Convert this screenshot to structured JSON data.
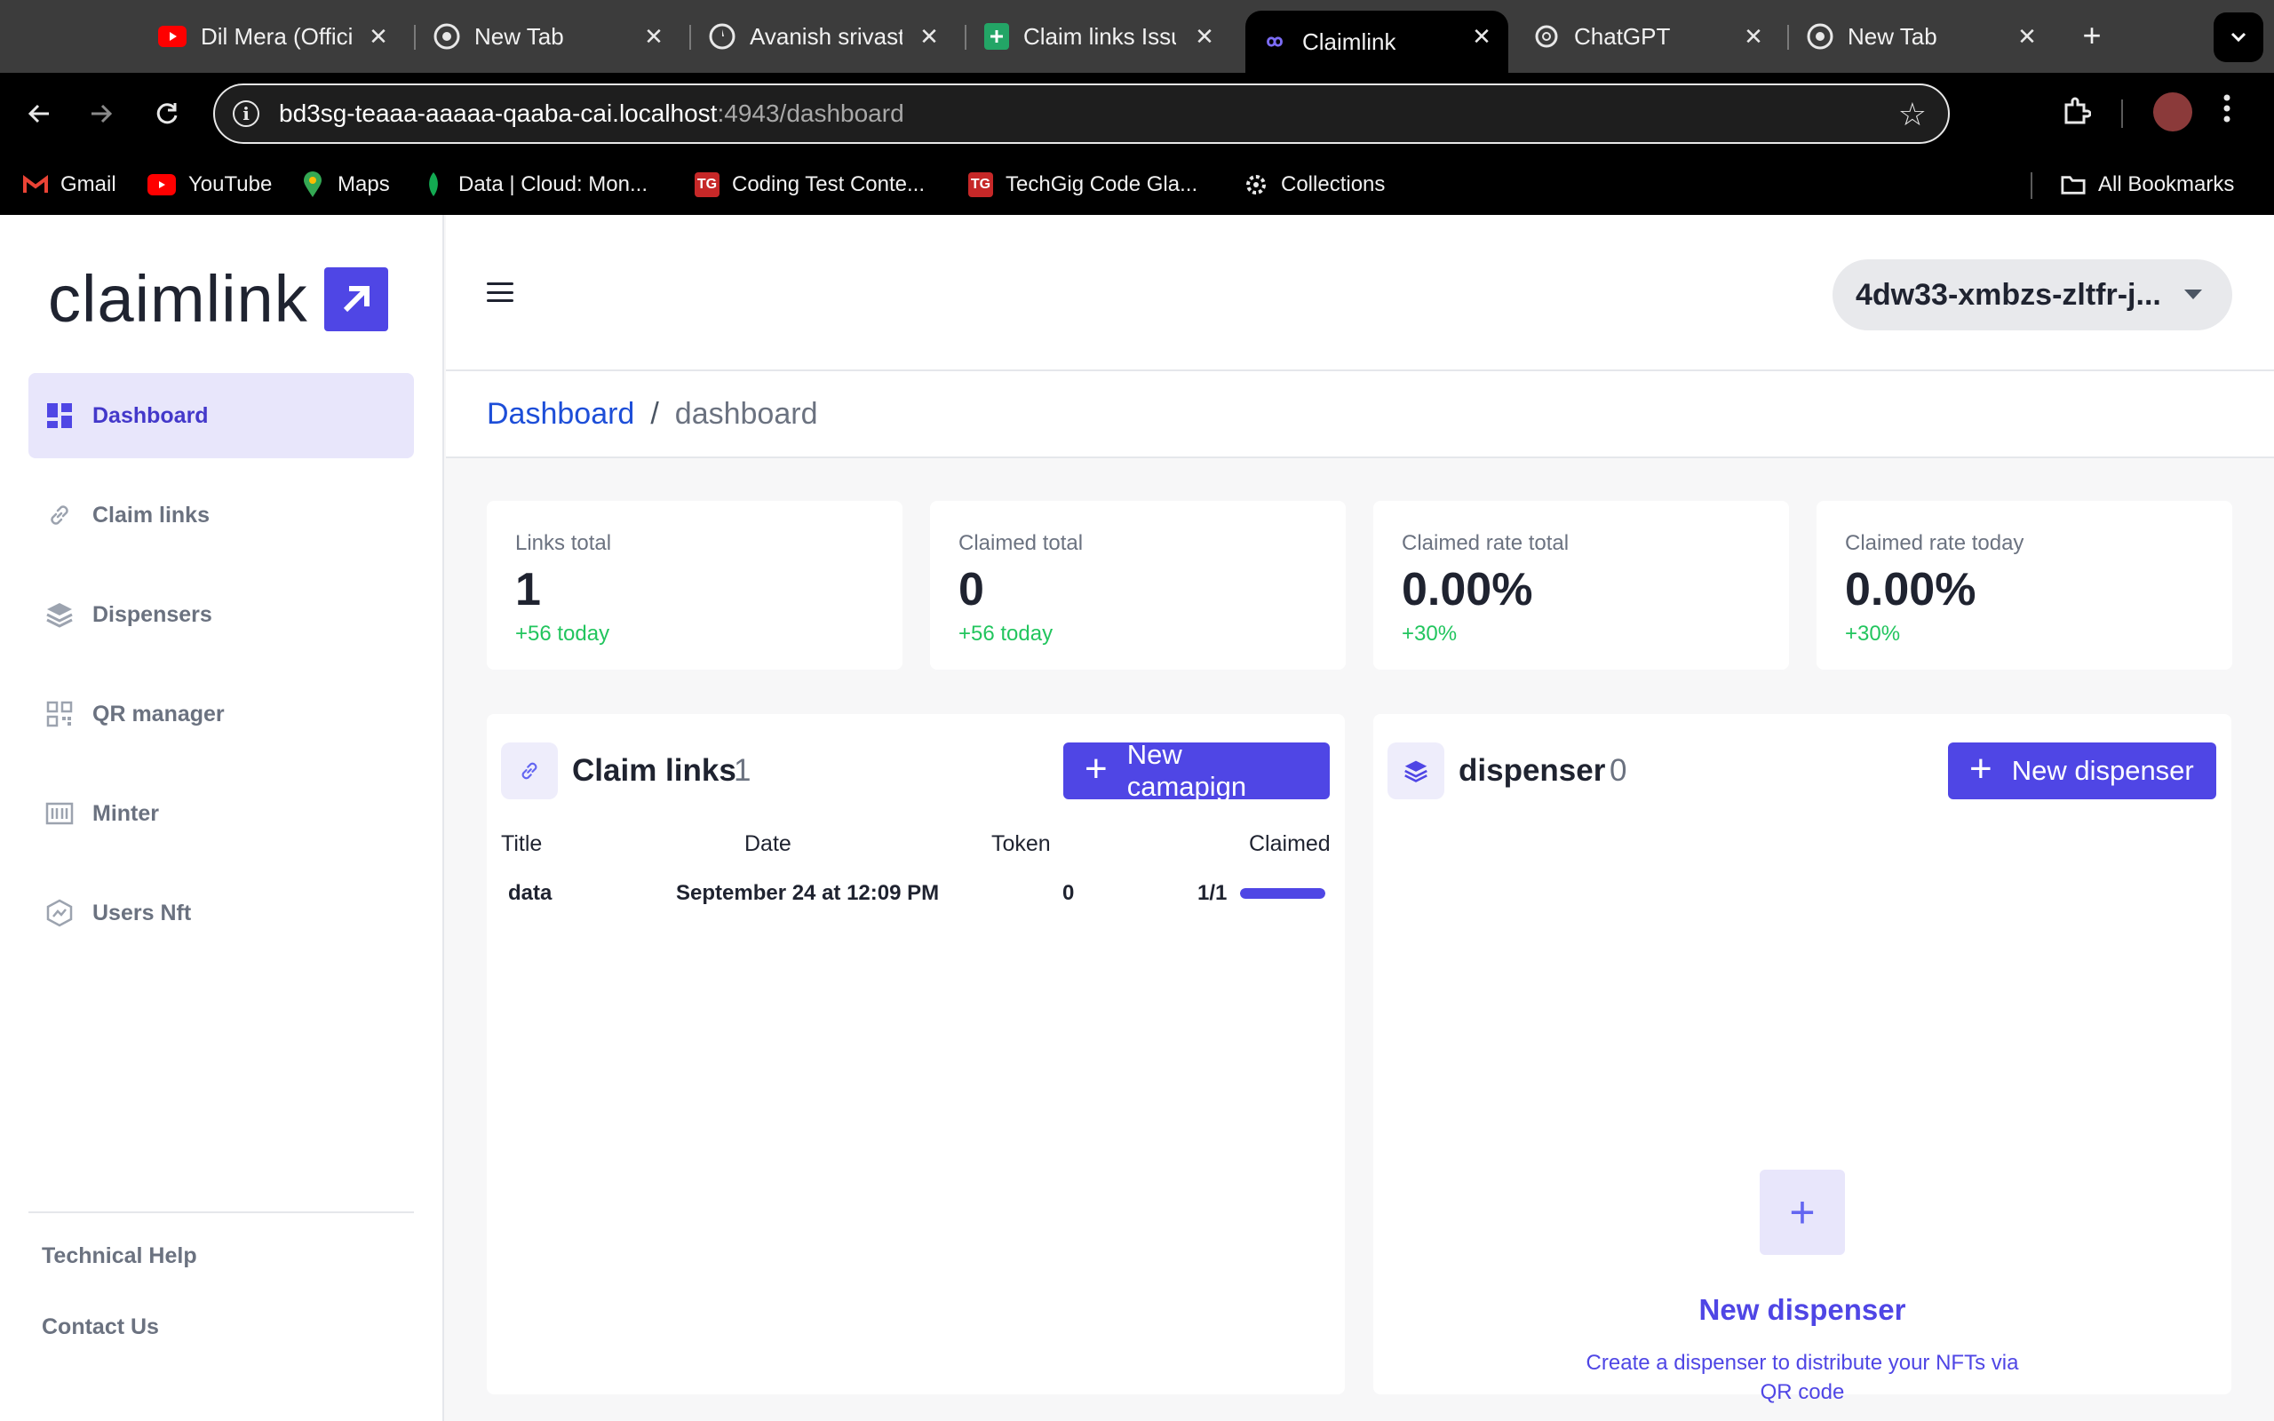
{
  "browser": {
    "tabs": [
      {
        "title": "Dil Mera (Offici",
        "icon": "youtube-icon",
        "active": false
      },
      {
        "title": "New Tab",
        "icon": "chrome-icon",
        "active": false
      },
      {
        "title": "Avanish srivast",
        "icon": "compass-icon",
        "active": false
      },
      {
        "title": "Claim links Issu",
        "icon": "sheets-icon",
        "active": false
      },
      {
        "title": "Claimlink",
        "icon": "infinity-icon",
        "active": true
      },
      {
        "title": "ChatGPT",
        "icon": "chatgpt-icon",
        "active": false
      },
      {
        "title": "New Tab",
        "icon": "chrome-icon",
        "active": false
      }
    ],
    "url_host": "bd3sg-teaaa-aaaaa-qaaba-cai.localhost",
    "url_rest": ":4943/dashboard",
    "bookmarks": [
      {
        "label": "Gmail",
        "icon": "gmail-icon"
      },
      {
        "label": "YouTube",
        "icon": "youtube-icon"
      },
      {
        "label": "Maps",
        "icon": "maps-icon"
      },
      {
        "label": "Data | Cloud: Mon...",
        "icon": "mongodb-leaf-icon"
      },
      {
        "label": "Coding Test Conte...",
        "icon": "techgig-icon"
      },
      {
        "label": "TechGig Code Gla...",
        "icon": "techgig-icon"
      },
      {
        "label": "Collections",
        "icon": "collections-icon"
      }
    ],
    "all_bookmarks": "All Bookmarks"
  },
  "sidebar": {
    "logo_text": "claimlink",
    "items": [
      {
        "label": "Dashboard",
        "icon": "grid-icon",
        "active": true
      },
      {
        "label": "Claim links",
        "icon": "link-icon",
        "active": false
      },
      {
        "label": "Dispensers",
        "icon": "layers-icon",
        "active": false
      },
      {
        "label": "QR manager",
        "icon": "qr-icon",
        "active": false
      },
      {
        "label": "Minter",
        "icon": "minter-icon",
        "active": false
      },
      {
        "label": "Users Nft",
        "icon": "hexagon-icon",
        "active": false
      }
    ],
    "footer_links": [
      "Technical Help",
      "Contact Us"
    ]
  },
  "header": {
    "principal": "4dw33-xmbzs-zltfr-j..."
  },
  "breadcrumb": {
    "link": "Dashboard",
    "separator": "/",
    "current": "dashboard"
  },
  "stats": [
    {
      "label": "Links total",
      "value": "1",
      "delta": "+56 today"
    },
    {
      "label": "Claimed total",
      "value": "0",
      "delta": "+56 today"
    },
    {
      "label": "Claimed rate total",
      "value": "0.00%",
      "delta": "+30%"
    },
    {
      "label": "Claimed rate today",
      "value": "0.00%",
      "delta": "+30%"
    }
  ],
  "claim_links": {
    "title": "Claim links",
    "count": "1",
    "button": "New camapign",
    "columns": [
      "Title",
      "Date",
      "Token",
      "Claimed"
    ],
    "rows": [
      {
        "title": "data",
        "date": "September 24 at 12:09 PM",
        "token": "0",
        "claimed": "1/1",
        "claimed_fraction": 1.0
      }
    ]
  },
  "dispenser": {
    "title": "dispenser",
    "count": "0",
    "button": "New dispenser",
    "empty_title": "New dispenser",
    "empty_desc": "Create a dispenser to distribute your NFTs via QR code"
  },
  "colors": {
    "accent": "#4f46e5",
    "delta_green": "#22c55e",
    "link_blue": "#1d4ed8"
  }
}
